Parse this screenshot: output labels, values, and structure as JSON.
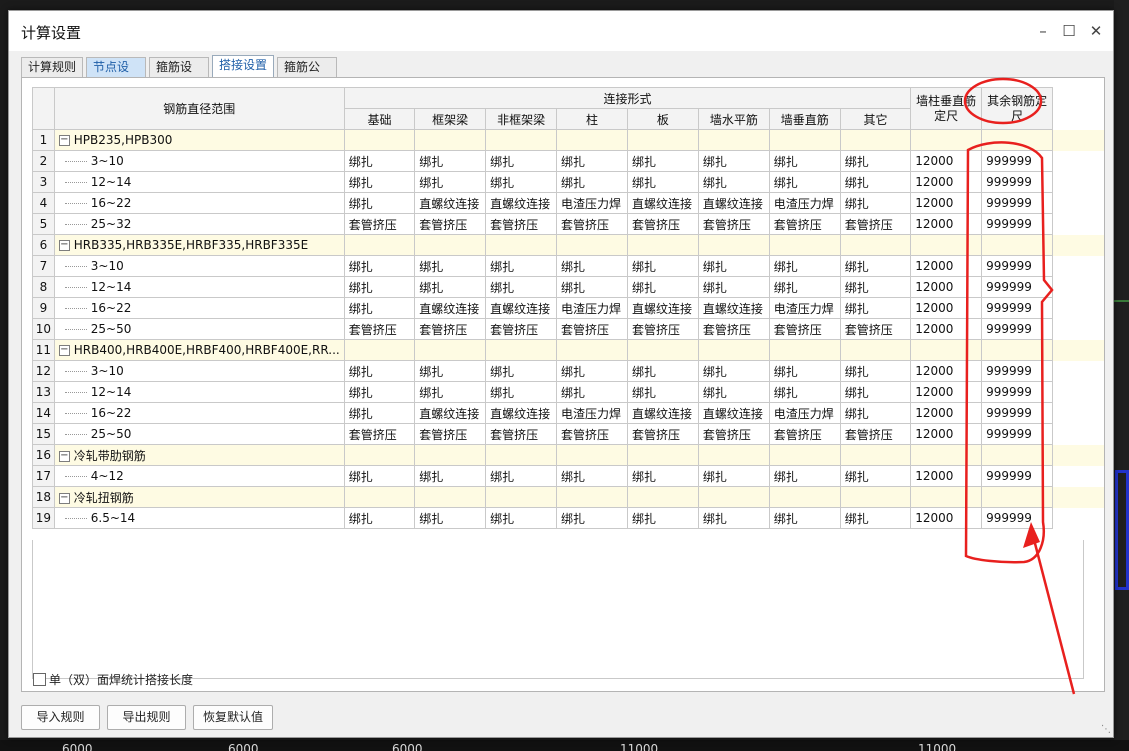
{
  "window": {
    "title": "计算设置",
    "minimize_icon": "minimize-icon",
    "maximize_icon": "maximize-icon",
    "close_icon": "close-icon"
  },
  "tabs": [
    {
      "label": "计算规则",
      "state": "normal"
    },
    {
      "label": "节点设置",
      "state": "highlighted"
    },
    {
      "label": "箍筋设置",
      "state": "normal"
    },
    {
      "label": "搭接设置",
      "state": "active"
    },
    {
      "label": "箍筋公式",
      "state": "normal"
    }
  ],
  "grid": {
    "header": {
      "range": "钢筋直径范围",
      "connection_group": "连接形式",
      "columns": [
        "基础",
        "框架梁",
        "非框架梁",
        "柱",
        "板",
        "墙水平筋",
        "墙垂直筋",
        "其它"
      ],
      "wall_length": [
        "墙柱垂直筋",
        "定尺"
      ],
      "other_length": [
        "其余钢筋定",
        "尺"
      ]
    },
    "rows": [
      {
        "n": "1",
        "type": "group",
        "label": "HPB235,HPB300"
      },
      {
        "n": "2",
        "type": "item",
        "label": "3~10",
        "values": [
          "绑扎",
          "绑扎",
          "绑扎",
          "绑扎",
          "绑扎",
          "绑扎",
          "绑扎",
          "绑扎"
        ],
        "wall": "12000",
        "other": "999999"
      },
      {
        "n": "3",
        "type": "item",
        "label": "12~14",
        "values": [
          "绑扎",
          "绑扎",
          "绑扎",
          "绑扎",
          "绑扎",
          "绑扎",
          "绑扎",
          "绑扎"
        ],
        "wall": "12000",
        "other": "999999"
      },
      {
        "n": "4",
        "type": "item",
        "label": "16~22",
        "values": [
          "绑扎",
          "直螺纹连接",
          "直螺纹连接",
          "电渣压力焊",
          "直螺纹连接",
          "直螺纹连接",
          "电渣压力焊",
          "绑扎"
        ],
        "wall": "12000",
        "other": "999999"
      },
      {
        "n": "5",
        "type": "item",
        "label": "25~32",
        "values": [
          "套管挤压",
          "套管挤压",
          "套管挤压",
          "套管挤压",
          "套管挤压",
          "套管挤压",
          "套管挤压",
          "套管挤压"
        ],
        "wall": "12000",
        "other": "999999"
      },
      {
        "n": "6",
        "type": "group",
        "label": "HRB335,HRB335E,HRBF335,HRBF335E"
      },
      {
        "n": "7",
        "type": "item",
        "label": "3~10",
        "values": [
          "绑扎",
          "绑扎",
          "绑扎",
          "绑扎",
          "绑扎",
          "绑扎",
          "绑扎",
          "绑扎"
        ],
        "wall": "12000",
        "other": "999999"
      },
      {
        "n": "8",
        "type": "item",
        "label": "12~14",
        "values": [
          "绑扎",
          "绑扎",
          "绑扎",
          "绑扎",
          "绑扎",
          "绑扎",
          "绑扎",
          "绑扎"
        ],
        "wall": "12000",
        "other": "999999"
      },
      {
        "n": "9",
        "type": "item",
        "label": "16~22",
        "values": [
          "绑扎",
          "直螺纹连接",
          "直螺纹连接",
          "电渣压力焊",
          "直螺纹连接",
          "直螺纹连接",
          "电渣压力焊",
          "绑扎"
        ],
        "wall": "12000",
        "other": "999999"
      },
      {
        "n": "10",
        "type": "item",
        "label": "25~50",
        "values": [
          "套管挤压",
          "套管挤压",
          "套管挤压",
          "套管挤压",
          "套管挤压",
          "套管挤压",
          "套管挤压",
          "套管挤压"
        ],
        "wall": "12000",
        "other": "999999"
      },
      {
        "n": "11",
        "type": "group",
        "label": "HRB400,HRB400E,HRBF400,HRBF400E,RR..."
      },
      {
        "n": "12",
        "type": "item",
        "label": "3~10",
        "values": [
          "绑扎",
          "绑扎",
          "绑扎",
          "绑扎",
          "绑扎",
          "绑扎",
          "绑扎",
          "绑扎"
        ],
        "wall": "12000",
        "other": "999999"
      },
      {
        "n": "13",
        "type": "item",
        "label": "12~14",
        "values": [
          "绑扎",
          "绑扎",
          "绑扎",
          "绑扎",
          "绑扎",
          "绑扎",
          "绑扎",
          "绑扎"
        ],
        "wall": "12000",
        "other": "999999"
      },
      {
        "n": "14",
        "type": "item",
        "label": "16~22",
        "values": [
          "绑扎",
          "直螺纹连接",
          "直螺纹连接",
          "电渣压力焊",
          "直螺纹连接",
          "直螺纹连接",
          "电渣压力焊",
          "绑扎"
        ],
        "wall": "12000",
        "other": "999999"
      },
      {
        "n": "15",
        "type": "item",
        "label": "25~50",
        "values": [
          "套管挤压",
          "套管挤压",
          "套管挤压",
          "套管挤压",
          "套管挤压",
          "套管挤压",
          "套管挤压",
          "套管挤压"
        ],
        "wall": "12000",
        "other": "999999"
      },
      {
        "n": "16",
        "type": "group",
        "label": "冷轧带肋钢筋"
      },
      {
        "n": "17",
        "type": "item",
        "label": "4~12",
        "values": [
          "绑扎",
          "绑扎",
          "绑扎",
          "绑扎",
          "绑扎",
          "绑扎",
          "绑扎",
          "绑扎"
        ],
        "wall": "12000",
        "other": "999999"
      },
      {
        "n": "18",
        "type": "group",
        "label": "冷轧扭钢筋"
      },
      {
        "n": "19",
        "type": "item",
        "label": "6.5~14",
        "values": [
          "绑扎",
          "绑扎",
          "绑扎",
          "绑扎",
          "绑扎",
          "绑扎",
          "绑扎",
          "绑扎"
        ],
        "wall": "12000",
        "other": "999999"
      }
    ]
  },
  "options": {
    "weld_checkbox_label": "单（双）面焊统计搭接长度",
    "weld_checked": false
  },
  "buttons": {
    "import": "导入规则",
    "export": "导出规则",
    "restore": "恢复默认值"
  },
  "background": {
    "values": [
      "6000",
      "6000",
      "6000",
      "11000",
      "11000"
    ]
  },
  "colors": {
    "annotation": "#e8201e",
    "group_row": "#fefbe3",
    "active_tab_text": "#1f5fa8"
  }
}
